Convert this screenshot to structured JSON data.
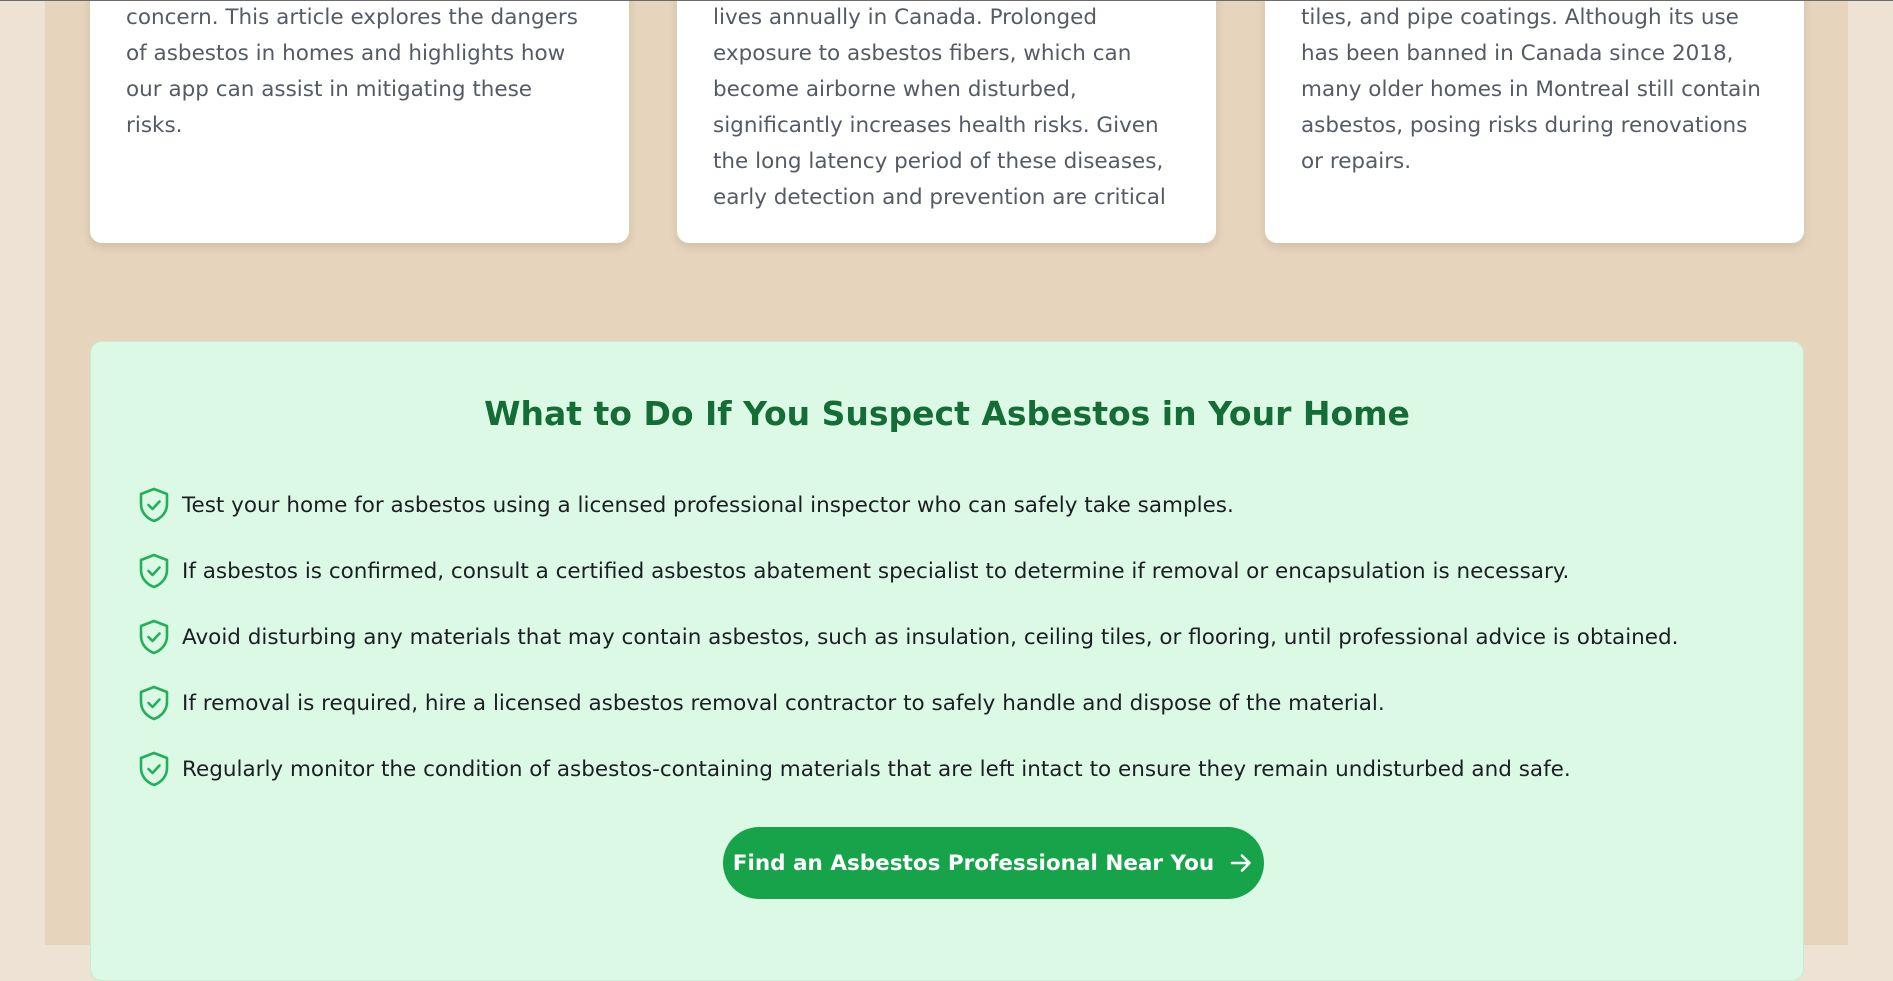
{
  "cards": [
    {
      "text": "concern. This article explores the dangers of asbestos in homes and highlights how our app can assist in mitigating these risks."
    },
    {
      "text": "lives annually in Canada. Prolonged exposure to asbestos fibers, which can become airborne when disturbed, significantly increases health risks. Given the long latency period of these diseases, early detection and prevention are critical"
    },
    {
      "text": "tiles, and pipe coatings. Although its use has been banned in Canada since 2018, many older homes in Montreal still contain asbestos, posing risks during renovations or repairs."
    }
  ],
  "guidance": {
    "title": "What to Do If You Suspect Asbestos in Your Home",
    "icon": "shield-check-icon",
    "steps": [
      "Test your home for asbestos using a licensed professional inspector who can safely take samples.",
      "If asbestos is confirmed, consult a certified asbestos abatement specialist to determine if removal or encapsulation is necessary.",
      "Avoid disturbing any materials that may contain asbestos, such as insulation, ceiling tiles, or flooring, until professional advice is obtained.",
      "If removal is required, hire a licensed asbestos removal contractor to safely handle and dispose of the material.",
      "Regularly monitor the condition of asbestos-containing materials that are left intact to ensure they remain undisturbed and safe."
    ],
    "cta_label": "Find an Asbestos Professional Near You",
    "cta_icon": "arrow-right-icon"
  },
  "colors": {
    "page_bg": "#ede2d3",
    "main_bg": "#e6d4bc",
    "panel_bg": "#dcf9e6",
    "title": "#146c36",
    "icon": "#22b05a",
    "cta_bg": "#17a34a",
    "card_text": "#555b66",
    "body_text": "#1b1f24"
  }
}
